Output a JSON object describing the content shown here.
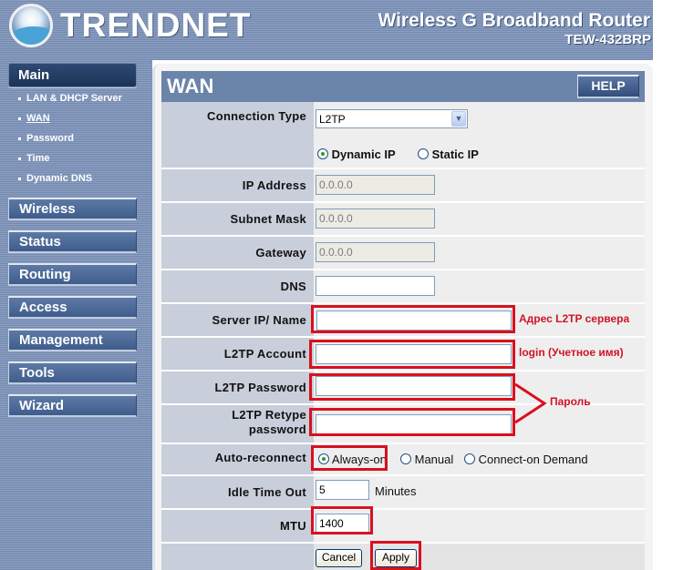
{
  "header": {
    "brand": "TRENDNET",
    "product_title": "Wireless G Broadband Router",
    "model": "TEW-432BRP"
  },
  "sidebar": {
    "main_label": "Main",
    "sub_items": [
      {
        "label": "LAN & DHCP Server",
        "active": false
      },
      {
        "label": "WAN",
        "active": true
      },
      {
        "label": "Password",
        "active": false
      },
      {
        "label": "Time",
        "active": false
      },
      {
        "label": "Dynamic DNS",
        "active": false
      }
    ],
    "sections": [
      {
        "label": "Wireless"
      },
      {
        "label": "Status"
      },
      {
        "label": "Routing"
      },
      {
        "label": "Access"
      },
      {
        "label": "Management"
      },
      {
        "label": "Tools"
      },
      {
        "label": "Wizard"
      }
    ]
  },
  "page": {
    "title": "WAN",
    "help_label": "HELP"
  },
  "form": {
    "connection_type": {
      "label": "Connection Type",
      "value": "L2TP"
    },
    "ip_mode": {
      "options": [
        "Dynamic IP",
        "Static IP"
      ],
      "selected": "Dynamic IP"
    },
    "ip_address": {
      "label": "IP Address",
      "value": "0.0.0.0"
    },
    "subnet_mask": {
      "label": "Subnet Mask",
      "value": "0.0.0.0"
    },
    "gateway": {
      "label": "Gateway",
      "value": "0.0.0.0"
    },
    "dns": {
      "label": "DNS",
      "value": ""
    },
    "server_ip": {
      "label": "Server IP/ Name",
      "value": ""
    },
    "account": {
      "label": "L2TP Account",
      "value": ""
    },
    "password": {
      "label": "L2TP Password",
      "value": ""
    },
    "retype_password": {
      "label_line1": "L2TP Retype",
      "label_line2": "password",
      "value": ""
    },
    "auto_reconnect": {
      "label": "Auto-reconnect",
      "options": [
        "Always-on",
        "Manual",
        "Connect-on Demand"
      ],
      "selected": "Always-on"
    },
    "idle_timeout": {
      "label": "Idle Time Out",
      "value": "5",
      "unit": "Minutes"
    },
    "mtu": {
      "label": "MTU",
      "value": "1400"
    },
    "cancel_label": "Cancel",
    "apply_label": "Apply"
  },
  "annotations": {
    "server": "Адрес L2TP сервера",
    "login": "login (Учетное имя)",
    "password": "Пароль",
    "color": "#d01425"
  }
}
